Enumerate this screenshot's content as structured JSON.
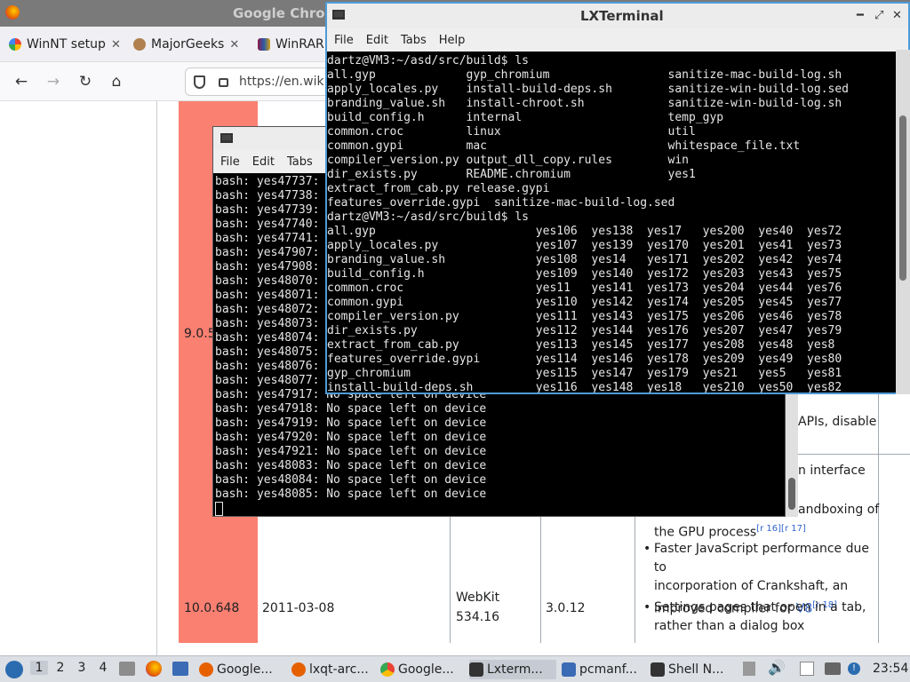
{
  "browser": {
    "title": "Google Chrome",
    "tabs": [
      {
        "label": "WinNT setup"
      },
      {
        "label": "MajorGeeks"
      },
      {
        "label": "WinRAR"
      }
    ],
    "url": "https://en.wik"
  },
  "page": {
    "version_text": "9.0.5",
    "row_version": "10.0.648",
    "row_date": "2011-03-08",
    "row_engine_1": "WebKit",
    "row_engine_2": "534.16",
    "row_v8": "3.0.12",
    "apis_text": "APIs, disable",
    "interface_text": "n interface",
    "sandboxing_text": "andboxing of",
    "gpu_text": "the GPU process",
    "gpu_refs": "[r 16][r 17]",
    "bullet_js_1": "Faster JavaScript performance due to",
    "bullet_js_2": "incorporation of Crankshaft, an",
    "bullet_js_3": "improved compiler for",
    "bullet_js_link": "V8",
    "bullet_js_ref": "[r 18]",
    "bullet_settings_1": "Settings pages that open in a tab,",
    "bullet_settings_2": "rather than a dialog box"
  },
  "term_back": {
    "menu": [
      "File",
      "Edit",
      "Tabs"
    ],
    "lines": [
      "bash: yes47737:",
      "bash: yes47738:",
      "bash: yes47739:",
      "bash: yes47740:",
      "bash: yes47741:",
      "bash: yes47907:",
      "bash: yes47908:",
      "bash: yes48070:",
      "bash: yes48071:",
      "bash: yes48072:",
      "bash: yes48073:",
      "bash: yes48074:",
      "bash: yes48075:",
      "bash: yes48076:",
      "bash: yes48077:",
      "bash: yes47917: No space left on device",
      "bash: yes47918: No space left on device",
      "bash: yes47919: No space left on device",
      "bash: yes47920: No space left on device",
      "bash: yes47921: No space left on device",
      "bash: yes48083: No space left on device",
      "bash: yes48084: No space left on device",
      "bash: yes48085: No space left on device"
    ]
  },
  "term_front": {
    "title": "LXTerminal",
    "menu": [
      "File",
      "Edit",
      "Tabs",
      "Help"
    ],
    "lines": [
      "dartz@VM3:~/asd/src/build$ ls",
      "all.gyp             gyp_chromium                 sanitize-mac-build-log.sh",
      "apply_locales.py    install-build-deps.sh        sanitize-win-build-log.sed",
      "branding_value.sh   install-chroot.sh            sanitize-win-build-log.sh",
      "build_config.h      internal                     temp_gyp",
      "common.croc         linux                        util",
      "common.gypi         mac                          whitespace_file.txt",
      "compiler_version.py output_dll_copy.rules        win",
      "dir_exists.py       README.chromium              yes1",
      "extract_from_cab.py release.gypi",
      "features_override.gypi  sanitize-mac-build-log.sed",
      "dartz@VM3:~/asd/src/build$ ls",
      "all.gyp                       yes106  yes138  yes17   yes200  yes40  yes72",
      "apply_locales.py              yes107  yes139  yes170  yes201  yes41  yes73",
      "branding_value.sh             yes108  yes14   yes171  yes202  yes42  yes74",
      "build_config.h                yes109  yes140  yes172  yes203  yes43  yes75",
      "common.croc                   yes11   yes141  yes173  yes204  yes44  yes76",
      "common.gypi                   yes110  yes142  yes174  yes205  yes45  yes77",
      "compiler_version.py           yes111  yes143  yes175  yes206  yes46  yes78",
      "dir_exists.py                 yes112  yes144  yes176  yes207  yes47  yes79",
      "extract_from_cab.py           yes113  yes145  yes177  yes208  yes48  yes8",
      "features_override.gypi        yes114  yes146  yes178  yes209  yes49  yes80",
      "gyp_chromium                  yes115  yes147  yes179  yes21   yes5   yes81",
      "install-build-deps.sh         yes116  yes148  yes18   yes210  yes50  yes82"
    ]
  },
  "taskbar": {
    "workspaces": [
      "1",
      "2",
      "3",
      "4"
    ],
    "tasks": [
      {
        "label": "Google...",
        "color": "#e66000"
      },
      {
        "label": "lxqt-arc...",
        "color": "#e66000"
      },
      {
        "label": "Google...",
        "color": "#4285f4"
      },
      {
        "label": "Lxterm...",
        "color": "#333333"
      },
      {
        "label": "pcmanf...",
        "color": "#3b6bb5"
      },
      {
        "label": "Shell N...",
        "color": "#333333"
      }
    ],
    "clock": "23:54"
  }
}
